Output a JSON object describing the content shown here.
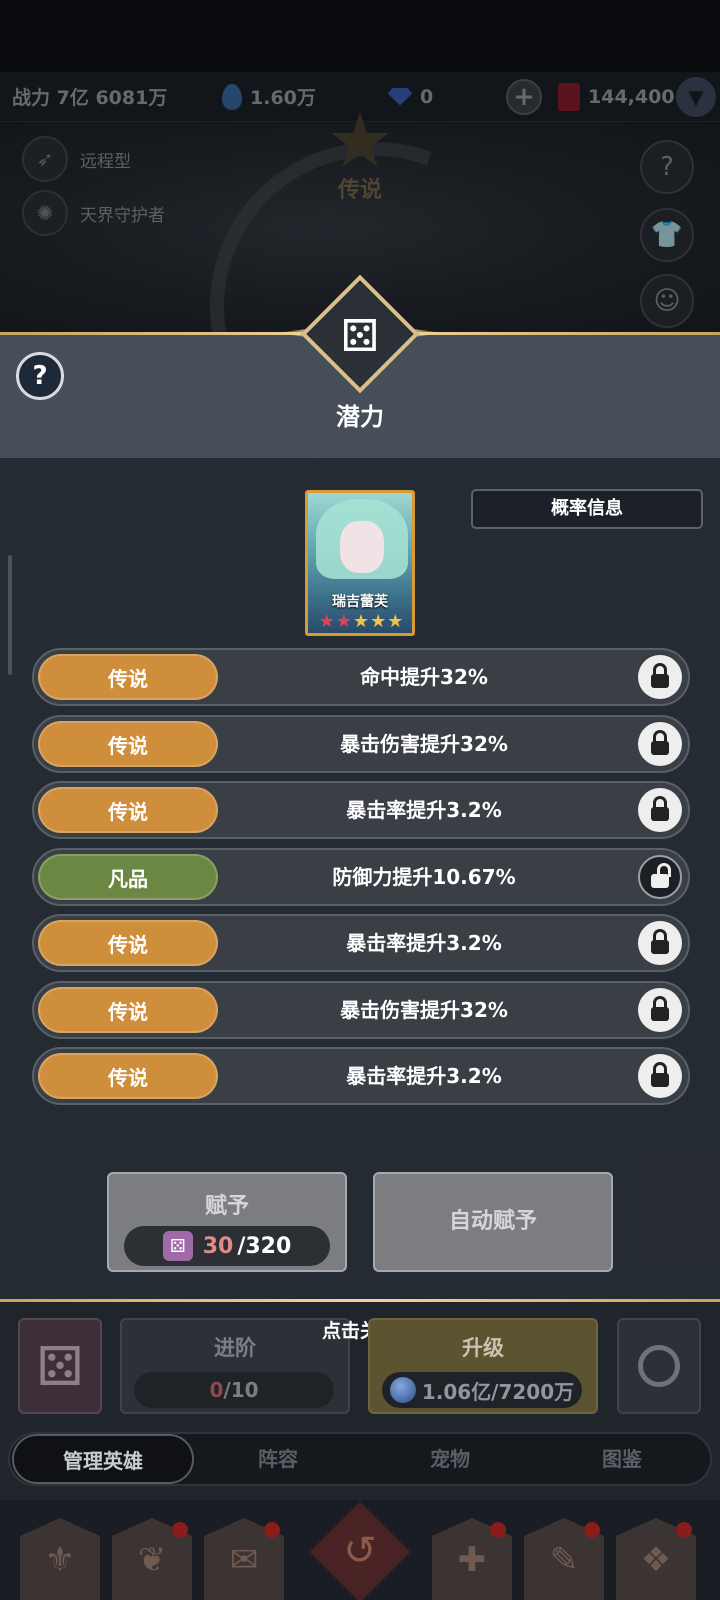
{
  "topbar": {
    "power_label": "战力 7亿 6081万",
    "crystals": "1.60万",
    "diamonds": "0",
    "gems": "144,400"
  },
  "scene": {
    "tag_type": "远程型",
    "tag_faction": "天界守护者",
    "badge": "传说"
  },
  "modal": {
    "title": "潜力",
    "help": "?",
    "hero_name": "瑞吉蕾芙",
    "hero_stars": {
      "red": 2,
      "gold": 3
    },
    "prob_button": "概率信息",
    "potentials": [
      {
        "grade": "传说",
        "grade_type": "legend",
        "effect": "命中提升32%",
        "locked": true
      },
      {
        "grade": "传说",
        "grade_type": "legend",
        "effect": "暴击伤害提升32%",
        "locked": true
      },
      {
        "grade": "传说",
        "grade_type": "legend",
        "effect": "暴击率提升3.2%",
        "locked": true
      },
      {
        "grade": "凡品",
        "grade_type": "common",
        "effect": "防御力提升10.67%",
        "locked": false
      },
      {
        "grade": "传说",
        "grade_type": "legend",
        "effect": "暴击率提升3.2%",
        "locked": true
      },
      {
        "grade": "传说",
        "grade_type": "legend",
        "effect": "暴击伤害提升32%",
        "locked": true
      },
      {
        "grade": "传说",
        "grade_type": "legend",
        "effect": "暴击率提升3.2%",
        "locked": true
      }
    ],
    "grant": {
      "label": "赋予",
      "current": "30",
      "max": "/320"
    },
    "auto_grant": "自动赋予"
  },
  "bottom": {
    "tap_close": "点击关闭",
    "advance": {
      "label": "进阶",
      "current": "0",
      "max": "/10"
    },
    "levelup": {
      "label": "升级",
      "cost": "1.06亿/7200万"
    },
    "tabs": [
      "管理英雄",
      "阵容",
      "宠物",
      "图鉴"
    ]
  },
  "colors": {
    "legend_grade": "#cf8e3b",
    "common_grade": "#6b8742",
    "accent_gold": "#f0d79a"
  }
}
